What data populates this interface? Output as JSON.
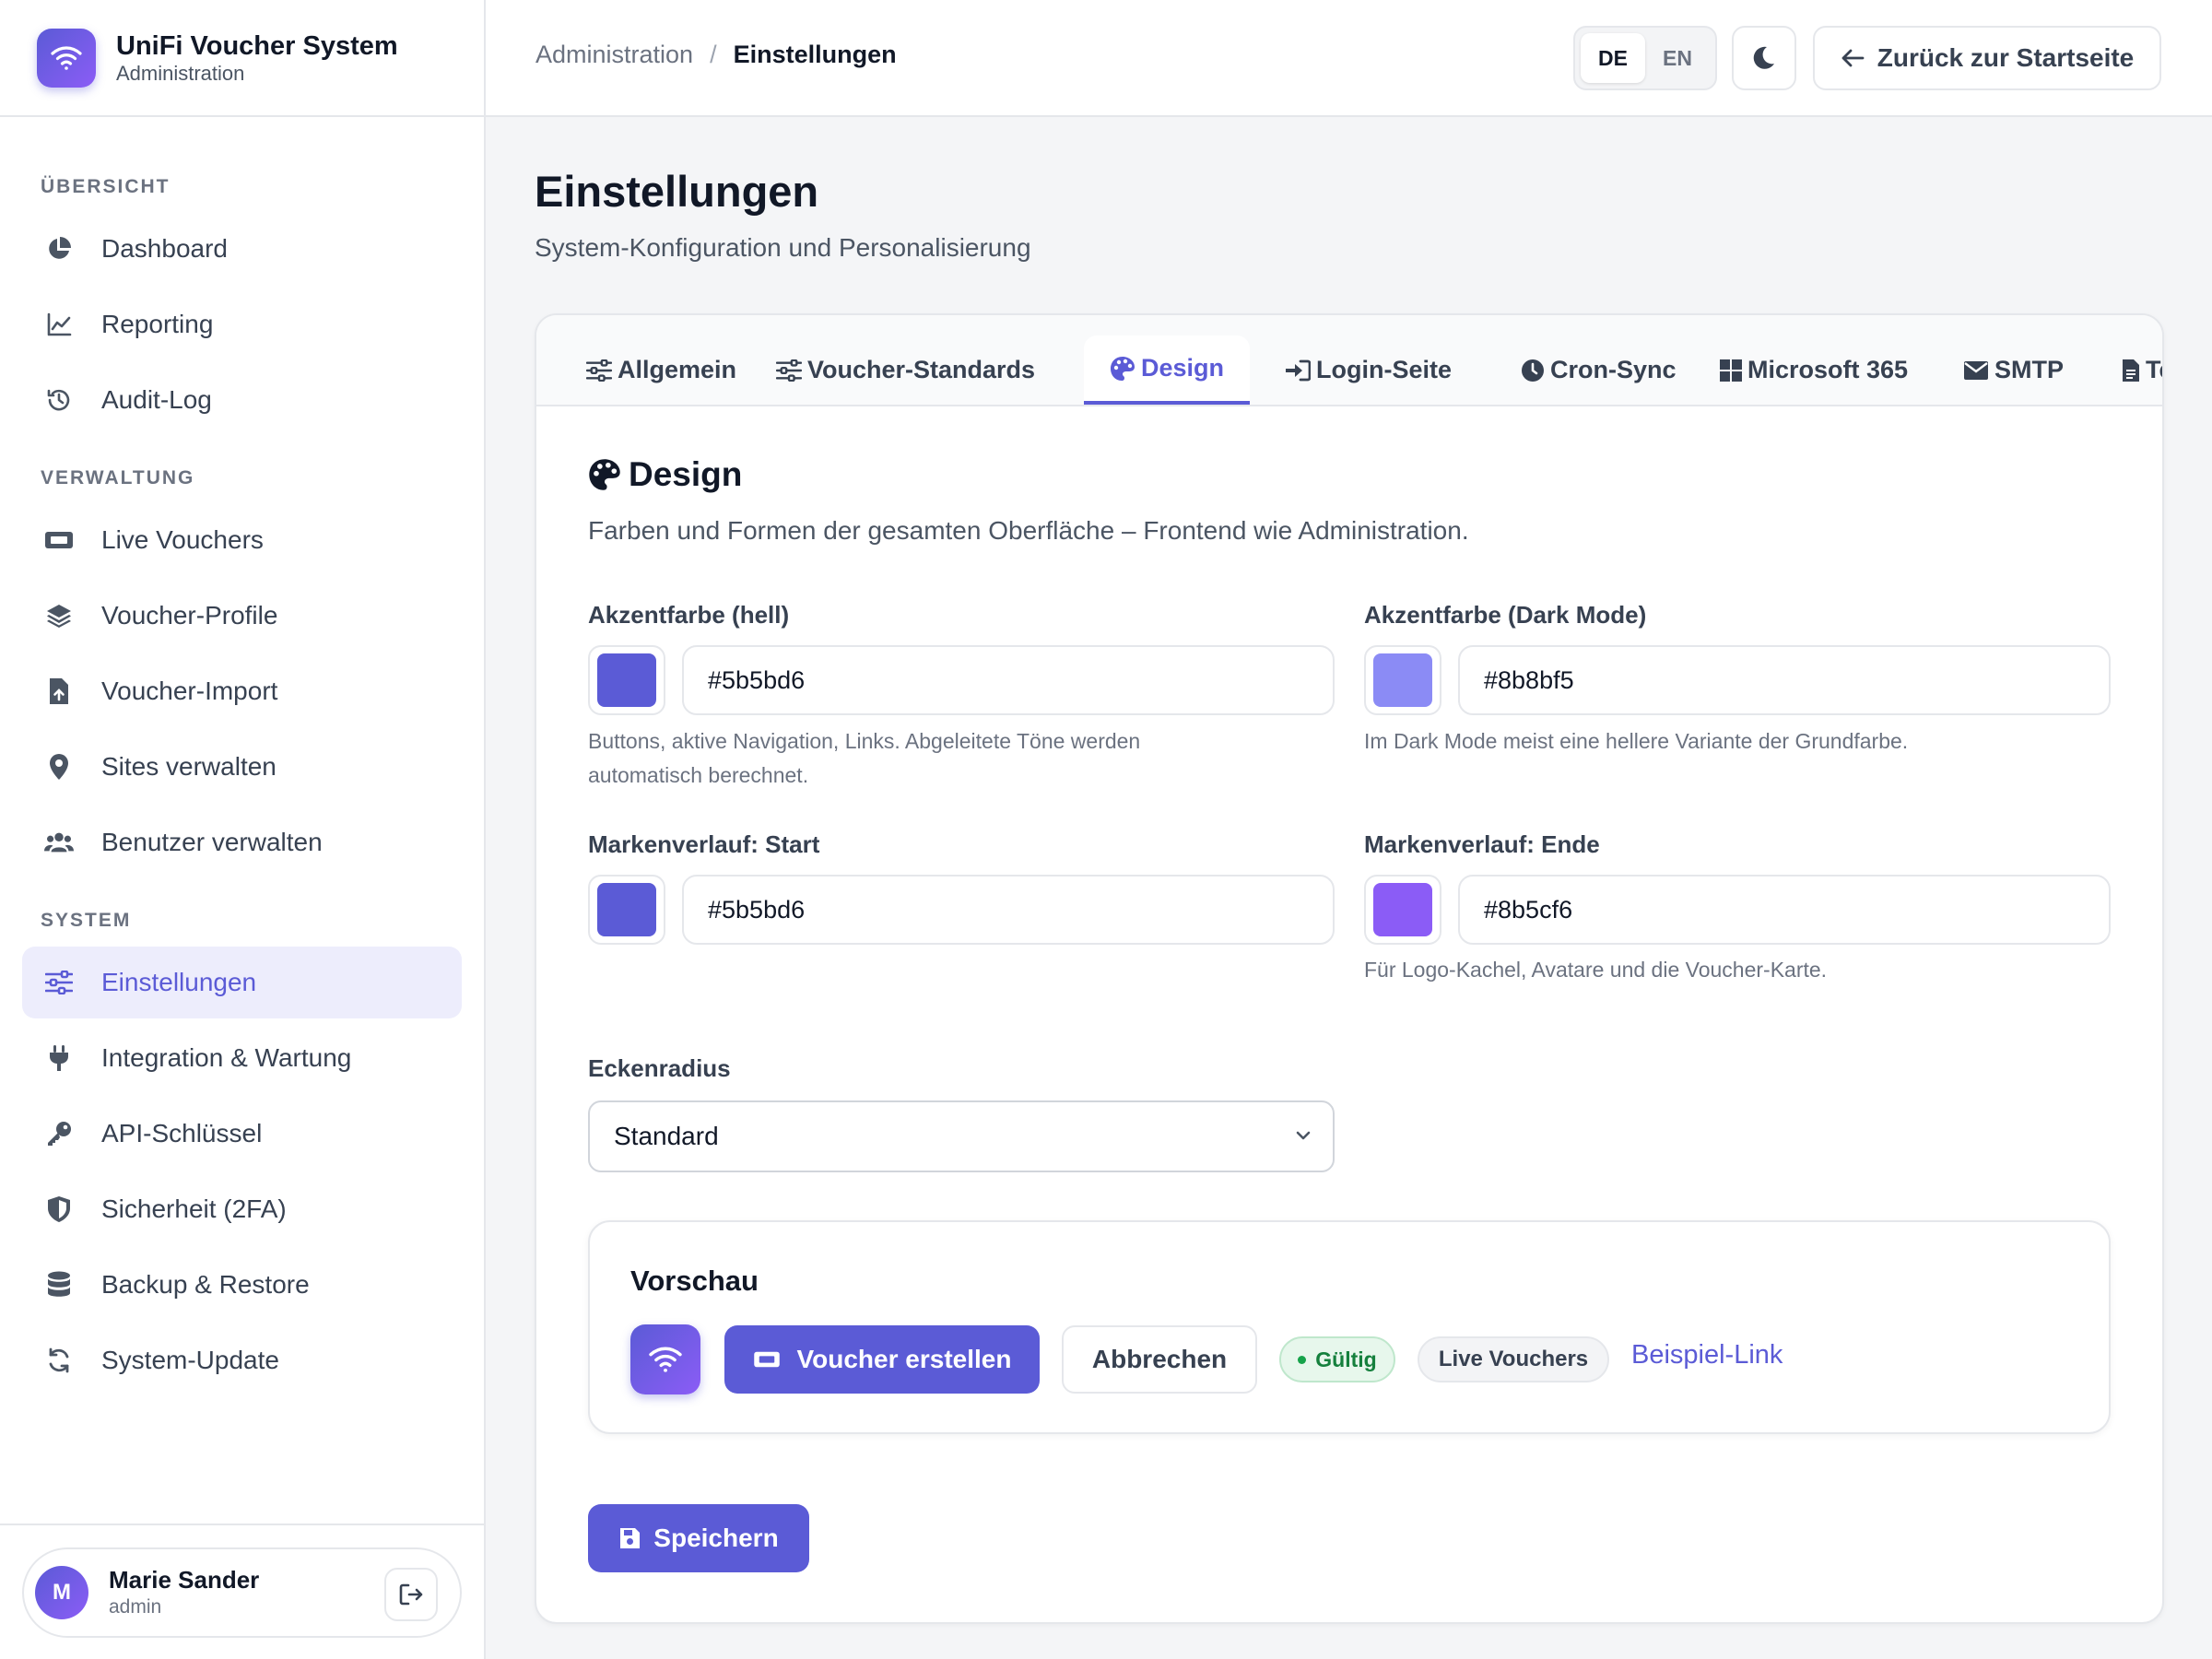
{
  "brand": {
    "title": "UniFi Voucher System",
    "subtitle": "Administration",
    "icon": "wifi-icon"
  },
  "sidebar": {
    "sections": [
      {
        "label": "ÜBERSICHT",
        "items": [
          {
            "label": "Dashboard",
            "icon": "pie-chart-icon"
          },
          {
            "label": "Reporting",
            "icon": "line-chart-icon"
          },
          {
            "label": "Audit-Log",
            "icon": "history-icon"
          }
        ]
      },
      {
        "label": "VERWALTUNG",
        "items": [
          {
            "label": "Live Vouchers",
            "icon": "ticket-icon"
          },
          {
            "label": "Voucher-Profile",
            "icon": "layers-icon"
          },
          {
            "label": "Voucher-Import",
            "icon": "file-upload-icon"
          },
          {
            "label": "Sites verwalten",
            "icon": "map-pin-icon"
          },
          {
            "label": "Benutzer verwalten",
            "icon": "users-icon"
          }
        ]
      },
      {
        "label": "SYSTEM",
        "items": [
          {
            "label": "Einstellungen",
            "icon": "sliders-icon",
            "active": true
          },
          {
            "label": "Integration & Wartung",
            "icon": "plug-icon"
          },
          {
            "label": "API-Schlüssel",
            "icon": "key-icon"
          },
          {
            "label": "Sicherheit (2FA)",
            "icon": "shield-icon"
          },
          {
            "label": "Backup & Restore",
            "icon": "database-icon"
          },
          {
            "label": "System-Update",
            "icon": "refresh-icon"
          }
        ]
      }
    ]
  },
  "user": {
    "initial": "M",
    "name": "Marie Sander",
    "role": "admin"
  },
  "topbar": {
    "breadcrumb_parent": "Administration",
    "breadcrumb_sep": "/",
    "breadcrumb_current": "Einstellungen",
    "languages": [
      "DE",
      "EN"
    ],
    "active_language": "DE",
    "back_label": "Zurück zur Startseite"
  },
  "page": {
    "title": "Einstellungen",
    "subtitle": "System-Konfiguration und Personalisierung"
  },
  "tabs": [
    {
      "label": "Allgemein",
      "icon": "sliders-icon"
    },
    {
      "label": "Voucher-Standards",
      "icon": "sliders-icon"
    },
    {
      "label": "Design",
      "icon": "palette-icon",
      "active": true
    },
    {
      "label": "Login-Seite",
      "icon": "sign-in-icon"
    },
    {
      "label": "Cron-Sync",
      "icon": "clock-icon"
    },
    {
      "label": "Microsoft 365",
      "icon": "windows-icon"
    },
    {
      "label": "SMTP",
      "icon": "envelope-icon"
    },
    {
      "label": "Te",
      "icon": "file-icon"
    }
  ],
  "design": {
    "title": "Design",
    "subtitle": "Farben und Formen der gesamten Oberfläche – Frontend wie Administration.",
    "accent_light": {
      "label": "Akzentfarbe (hell)",
      "value": "#5b5bd6",
      "help": "Buttons, aktive Navigation, Links. Abgeleitete Töne werden automatisch berechnet."
    },
    "accent_dark": {
      "label": "Akzentfarbe (Dark Mode)",
      "value": "#8b8bf5",
      "help": "Im Dark Mode meist eine hellere Variante der Grundfarbe."
    },
    "gradient_start": {
      "label": "Markenverlauf: Start",
      "value": "#5b5bd6"
    },
    "gradient_end": {
      "label": "Markenverlauf: Ende",
      "value": "#8b5cf6",
      "help": "Für Logo-Kachel, Avatare und die Voucher-Karte."
    },
    "radius": {
      "label": "Eckenradius",
      "value": "Standard"
    },
    "preview": {
      "title": "Vorschau",
      "primary_label": "Voucher erstellen",
      "secondary_label": "Abbrechen",
      "badge_valid": "Gültig",
      "badge_gray": "Live Vouchers",
      "link_label": "Beispiel-Link"
    },
    "save_label": "Speichern"
  },
  "colors": {
    "accent": "#5b5bd6",
    "accent_dark": "#8b8bf5",
    "gradient_end": "#8b5cf6",
    "success": "#16a34a"
  }
}
